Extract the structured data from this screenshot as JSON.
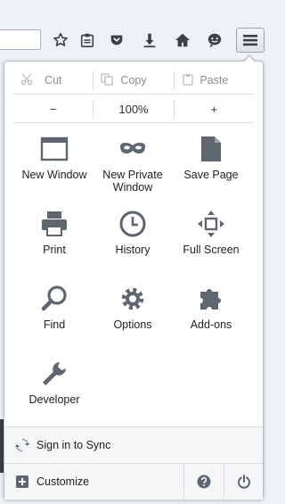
{
  "menu": {
    "edit": {
      "cut": "Cut",
      "copy": "Copy",
      "paste": "Paste"
    },
    "zoom": {
      "minus": "−",
      "level": "100%",
      "plus": "+"
    },
    "items": [
      {
        "label": "New Window",
        "icon": "new-window-icon"
      },
      {
        "label": "New Private Window",
        "icon": "private-mask-icon"
      },
      {
        "label": "Save Page",
        "icon": "save-page-icon"
      },
      {
        "label": "Print",
        "icon": "printer-icon"
      },
      {
        "label": "History",
        "icon": "clock-icon"
      },
      {
        "label": "Full Screen",
        "icon": "fullscreen-icon"
      },
      {
        "label": "Find",
        "icon": "magnifier-icon"
      },
      {
        "label": "Options",
        "icon": "gear-icon"
      },
      {
        "label": "Add-ons",
        "icon": "puzzle-icon"
      },
      {
        "label": "Developer",
        "icon": "wrench-icon"
      }
    ],
    "sync": "Sign in to Sync",
    "customize": "Customize"
  },
  "colors": {
    "icon": "#5f6670",
    "accent": "#2b5ea7"
  }
}
